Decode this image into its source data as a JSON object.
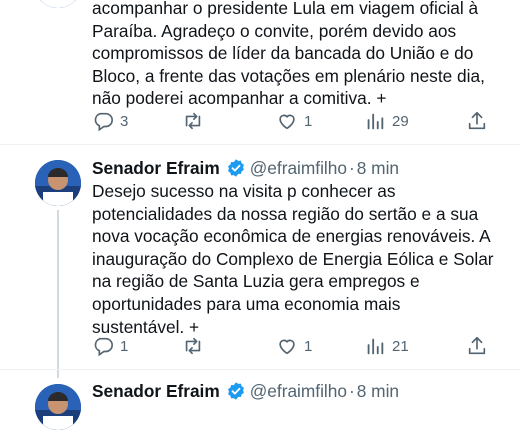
{
  "tweets": [
    {
      "text_lines": [
        "acompanhar o presidente Lula em viagem oficial à",
        "Paraíba. Agradeço o convite, porém devido aos",
        "compromissos de líder da bancada do União e do",
        "Bloco, a frente das votações em plenário neste dia,",
        "não poderei acompanhar a comitiva. +"
      ],
      "replies": "3",
      "retweets": "",
      "likes": "1",
      "views": "29"
    },
    {
      "name": "Senador Efraim",
      "handle": "@efraimfilho",
      "separator": "·",
      "time": "8 min",
      "text_lines": [
        "Desejo sucesso na visita p conhecer as",
        "potencialidades da nossa região do sertão e a sua",
        "nova vocação econômica de energias renováveis. A",
        "inauguração do Complexo de Energia Eólica e Solar",
        "na região de Santa Luzia gera empregos e",
        "oportunidades para uma economia mais",
        "sustentável. +"
      ],
      "replies": "1",
      "retweets": "",
      "likes": "1",
      "views": "21"
    },
    {
      "name": "Senador Efraim",
      "handle": "@efraimfilho",
      "separator": "·",
      "time": "8 min"
    }
  ],
  "colors": {
    "verified": "#1d9bf0",
    "muted": "#536471",
    "thread_line": "#cfd9de"
  },
  "icons": [
    "reply-icon",
    "retweet-icon",
    "like-icon",
    "views-icon",
    "share-icon",
    "verified-badge-icon"
  ]
}
